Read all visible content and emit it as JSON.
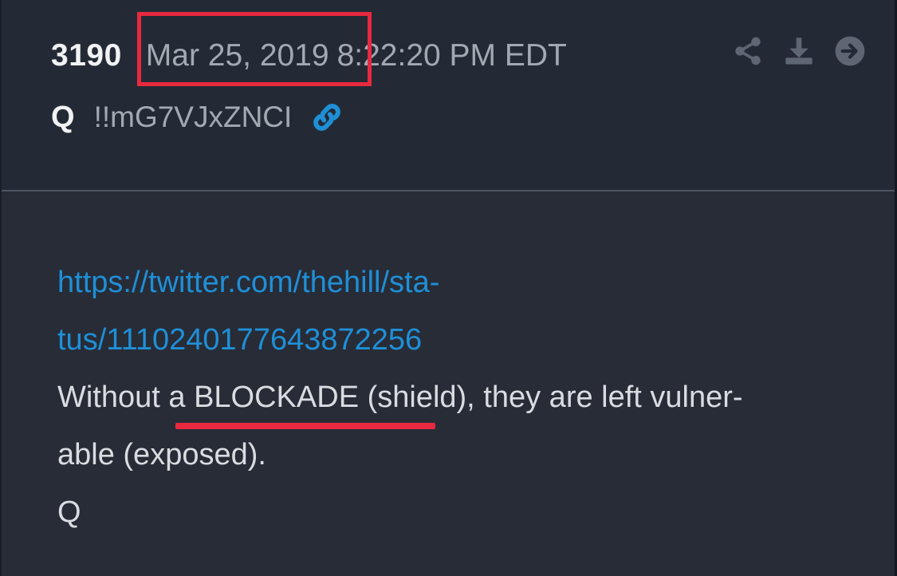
{
  "post": {
    "number": "3190",
    "date": "Mar 25, 2019",
    "time": "8:22:20 PM EDT",
    "author": "Q",
    "tripcode": "!!mG7VJxZNCI",
    "url_line1": "https://twitter.com/thehill/sta-",
    "url_line2": "tus/1110240177643872256",
    "text_line1": "Without a BLOCKADE (shield), they are left vulner-",
    "text_line2": "able (exposed).",
    "signature": "Q"
  },
  "icons": {
    "link": "link-icon",
    "share": "share-icon",
    "download": "download-icon",
    "next": "arrow-right-circle-icon"
  },
  "colors": {
    "background": "#272c37",
    "header_background": "#242a35",
    "link": "#1f8fd6",
    "highlight": "#e8293f",
    "muted_text": "#a3a9b3",
    "body_text": "#d9dce0"
  }
}
